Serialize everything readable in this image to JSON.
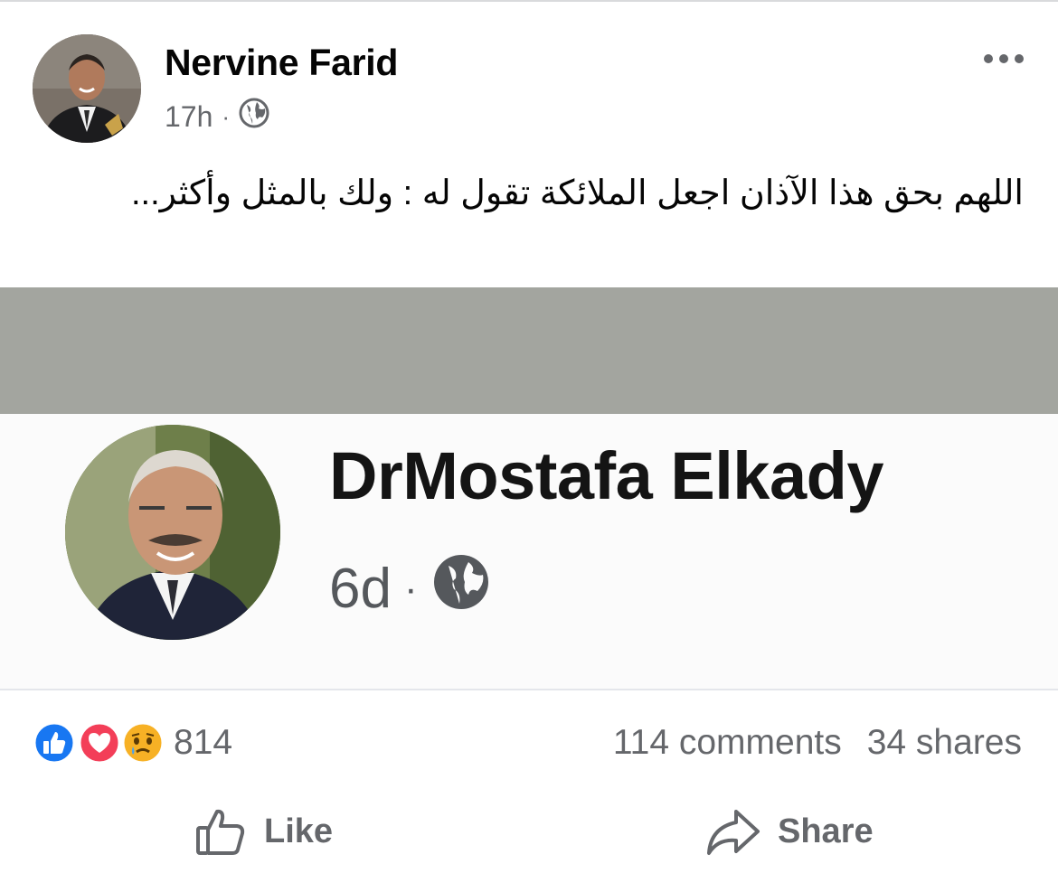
{
  "post": {
    "author": "Nervine Farid",
    "time": "17h",
    "separator": "·",
    "privacy_icon": "globe-icon",
    "text": "اللهم بحق هذا الآذان اجعل الملائكة تقول له : ولك بالمثل وأكثر..."
  },
  "shared_image": {
    "author": "DrMostafa Elkady",
    "time": "6d",
    "separator": "·",
    "privacy_icon": "globe-icon"
  },
  "engagement": {
    "reaction_icons": [
      "like-icon",
      "love-icon",
      "sad-icon"
    ],
    "reaction_count": "814",
    "comments": "114 comments",
    "shares": "34 shares"
  },
  "actions": {
    "like_label": "Like",
    "share_label": "Share"
  },
  "colors": {
    "like_blue": "#1877f2",
    "love_red": "#f33e58",
    "sad_yellow": "#f7b125",
    "secondary_text": "#65676b"
  }
}
